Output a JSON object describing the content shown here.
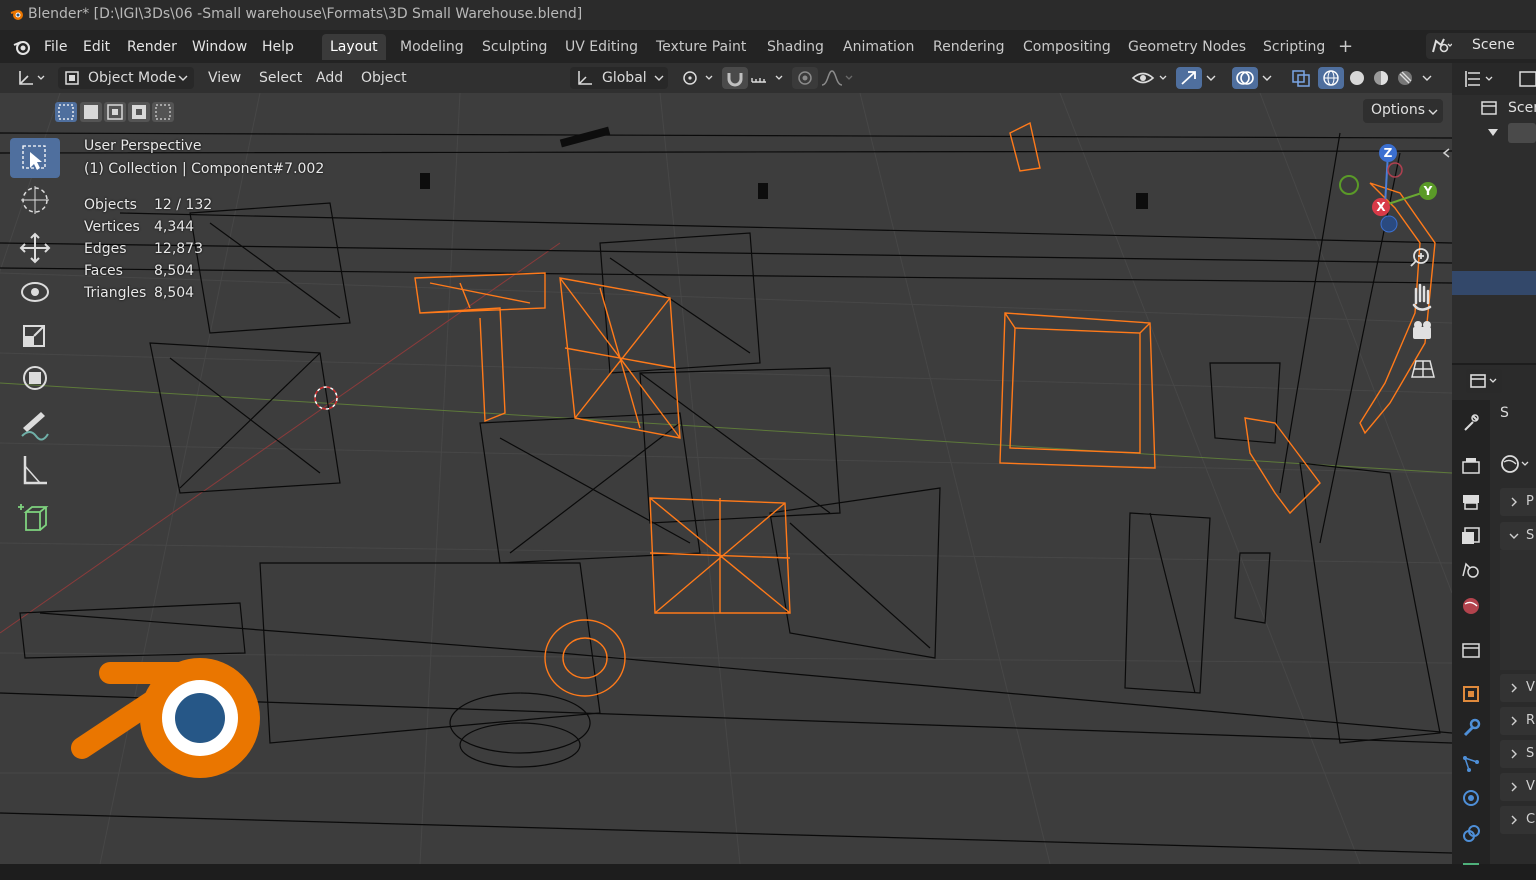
{
  "window": {
    "title": "Blender* [D:\\IGI\\3Ds\\06 -Small warehouse\\Formats\\3D Small Warehouse.blend]"
  },
  "menubar": {
    "items": [
      "File",
      "Edit",
      "Render",
      "Window",
      "Help"
    ]
  },
  "workspaces": {
    "tabs": [
      "Layout",
      "Modeling",
      "Sculpting",
      "UV Editing",
      "Texture Paint",
      "Shading",
      "Animation",
      "Rendering",
      "Compositing",
      "Geometry Nodes",
      "Scripting"
    ],
    "active": "Layout",
    "add_label": "+"
  },
  "scene": {
    "label": "Scene"
  },
  "viewport_header": {
    "mode": "Object Mode",
    "menus": [
      "View",
      "Select",
      "Add",
      "Object"
    ],
    "orientation": "Global",
    "options_label": "Options"
  },
  "viewport": {
    "perspective": "User Perspective",
    "collection": "(1) Collection | Component#7.002",
    "stats": [
      {
        "label": "Objects",
        "value": "12 / 132"
      },
      {
        "label": "Vertices",
        "value": "4,344"
      },
      {
        "label": "Edges",
        "value": "12,873"
      },
      {
        "label": "Faces",
        "value": "8,504"
      },
      {
        "label": "Triangles",
        "value": "8,504"
      }
    ],
    "gizmo": {
      "x": "X",
      "y": "Y",
      "z": "Z"
    }
  },
  "outliner": {
    "root_label": "Scen"
  },
  "properties": {
    "section_letters": [
      "P",
      "S",
      "V",
      "R",
      "S",
      "V",
      "C"
    ],
    "top_letter": "S"
  },
  "colors": {
    "selected": "#ff7a1a",
    "wire": "#0a0a0a",
    "active_tool": "#4f6f9e",
    "logo_orange": "#ea7600",
    "logo_blue": "#265787"
  }
}
